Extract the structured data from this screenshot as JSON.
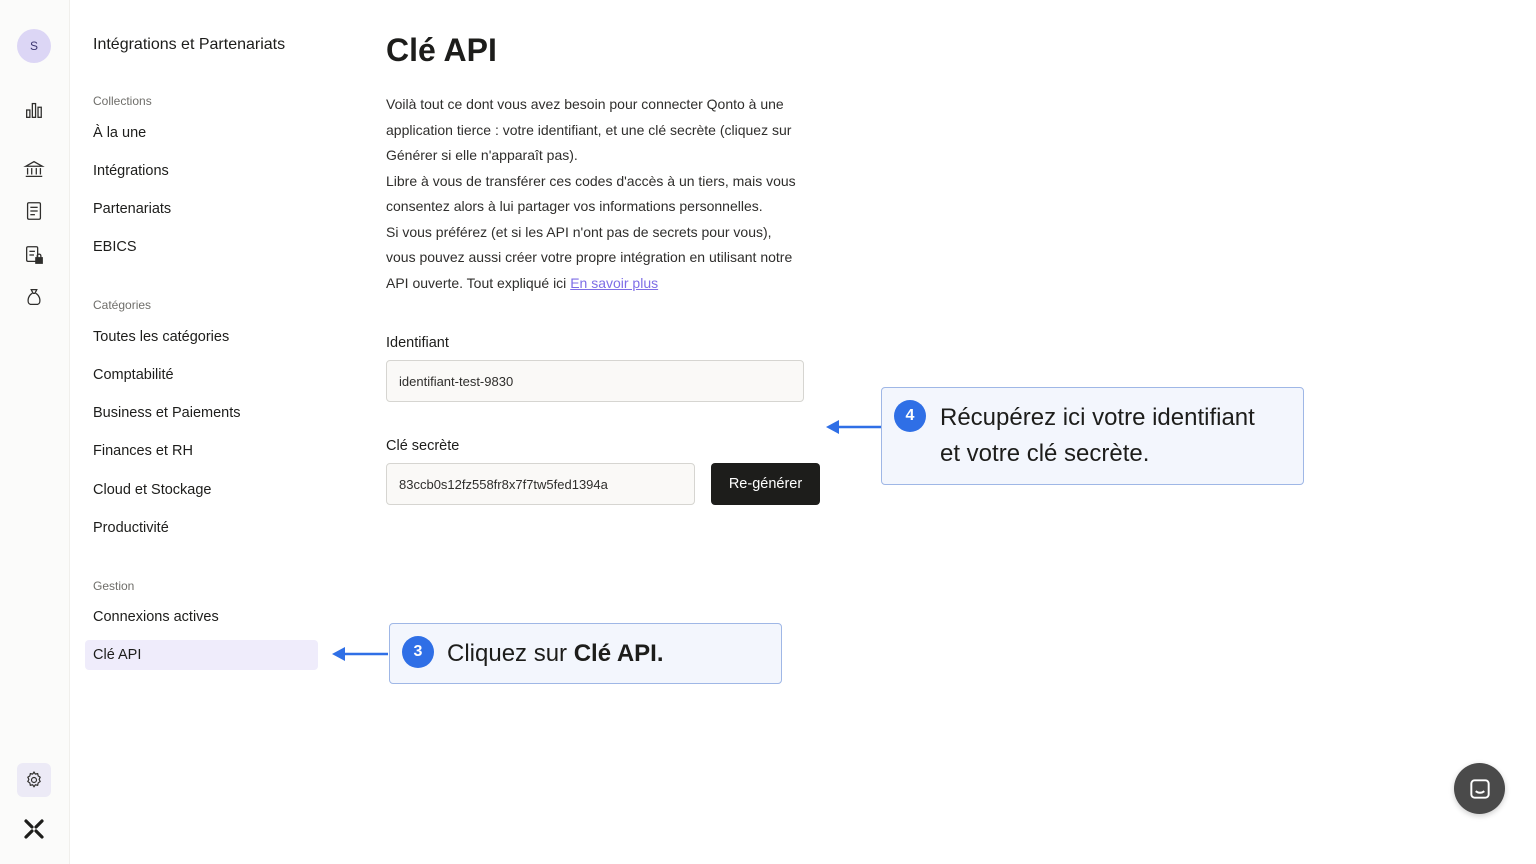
{
  "rail": {
    "avatar_letter": "S",
    "icons": [
      "bar-chart-icon",
      "bank-icon",
      "document-icon",
      "document-lock-icon",
      "money-bag-icon"
    ],
    "settings_icon": "gear-icon",
    "logo_icon": "qonto-logo-icon"
  },
  "subnav": {
    "title": "Intégrations et Partenariats",
    "sections": [
      {
        "label": "Collections",
        "items": [
          "À la une",
          "Intégrations",
          "Partenariats",
          "EBICS"
        ]
      },
      {
        "label": "Catégories",
        "items": [
          "Toutes les catégories",
          "Comptabilité",
          "Business et Paiements",
          "Finances et RH",
          "Cloud et Stockage",
          "Productivité"
        ]
      },
      {
        "label": "Gestion",
        "items": [
          "Connexions actives",
          "Clé API"
        ]
      }
    ],
    "active_item": "Clé API"
  },
  "main": {
    "title": "Clé API",
    "description_lines": [
      "Voilà tout ce dont vous avez besoin pour connecter Qonto à une",
      "application tierce : votre identifiant, et une clé secrète (cliquez sur",
      "Générer si elle n'apparaît pas).",
      "Libre à vous de transférer ces codes d'accès à un tiers, mais vous",
      "consentez alors à lui partager vos informations personnelles.",
      "Si vous préférez (et si les API n'ont pas de secrets pour vous),",
      "vous pouvez aussi créer votre propre intégration en utilisant notre"
    ],
    "description_last_line": "API ouverte. Tout expliqué ici ",
    "learn_more_link": "En savoir plus",
    "identifier_label": "Identifiant",
    "identifier_value": "identifiant-test-9830",
    "secret_label": "Clé secrète",
    "secret_value": "83ccb0s12fz558fr8x7f7tw5fed1394a",
    "regenerate_button": "Re-générer"
  },
  "callouts": {
    "step3_number": "3",
    "step3_text_prefix": "Cliquez sur ",
    "step3_text_bold": "Clé API.",
    "step4_number": "4",
    "step4_line1": "Récupérez ici votre identifiant",
    "step4_line2": "et votre clé secrète.",
    "accent_color": "#2f6fe6"
  },
  "chat": {
    "icon": "chat-icon"
  }
}
